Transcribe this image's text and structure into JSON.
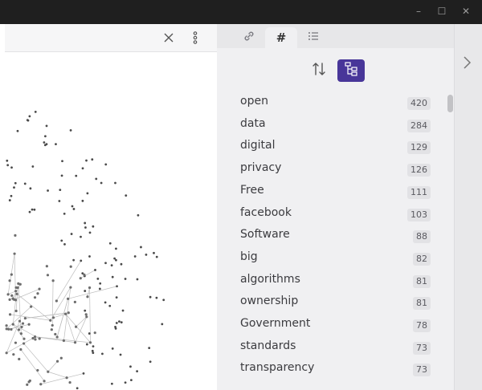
{
  "window": {
    "controls": [
      {
        "name": "minimize",
        "glyph": "–"
      },
      {
        "name": "maximize",
        "glyph": "☐"
      },
      {
        "name": "close",
        "glyph": "✕"
      }
    ]
  },
  "left_pane": {
    "header_icons": [
      "close-icon",
      "more-options-icon"
    ],
    "graph_view": {
      "content": "graph-nodes-links"
    }
  },
  "right_pane": {
    "tabs": [
      {
        "id": "backlinks",
        "icon": "link-icon",
        "active": false
      },
      {
        "id": "tags",
        "icon": "hash-icon",
        "glyph": "#",
        "active": true
      },
      {
        "id": "outline",
        "icon": "list-icon",
        "active": false
      }
    ],
    "toolbar": [
      {
        "id": "sort",
        "icon": "sort-icon",
        "active": false
      },
      {
        "id": "tree",
        "icon": "tree-view-icon",
        "active": true
      }
    ],
    "tags": [
      {
        "name": "open",
        "count": "420"
      },
      {
        "name": "data",
        "count": "284"
      },
      {
        "name": "digital",
        "count": "129"
      },
      {
        "name": "privacy",
        "count": "126"
      },
      {
        "name": "Free",
        "count": "111"
      },
      {
        "name": "facebook",
        "count": "103"
      },
      {
        "name": "Software",
        "count": "88"
      },
      {
        "name": "big",
        "count": "82"
      },
      {
        "name": "algorithms",
        "count": "81"
      },
      {
        "name": "ownership",
        "count": "81"
      },
      {
        "name": "Government",
        "count": "78"
      },
      {
        "name": "standards",
        "count": "73"
      },
      {
        "name": "transparency",
        "count": "73"
      }
    ]
  },
  "side_strip": {
    "expand_icon": "chevron-right-icon"
  },
  "colors": {
    "accent": "#483699",
    "titlebar": "#1f1f1f",
    "panel": "#f0f0f2"
  }
}
